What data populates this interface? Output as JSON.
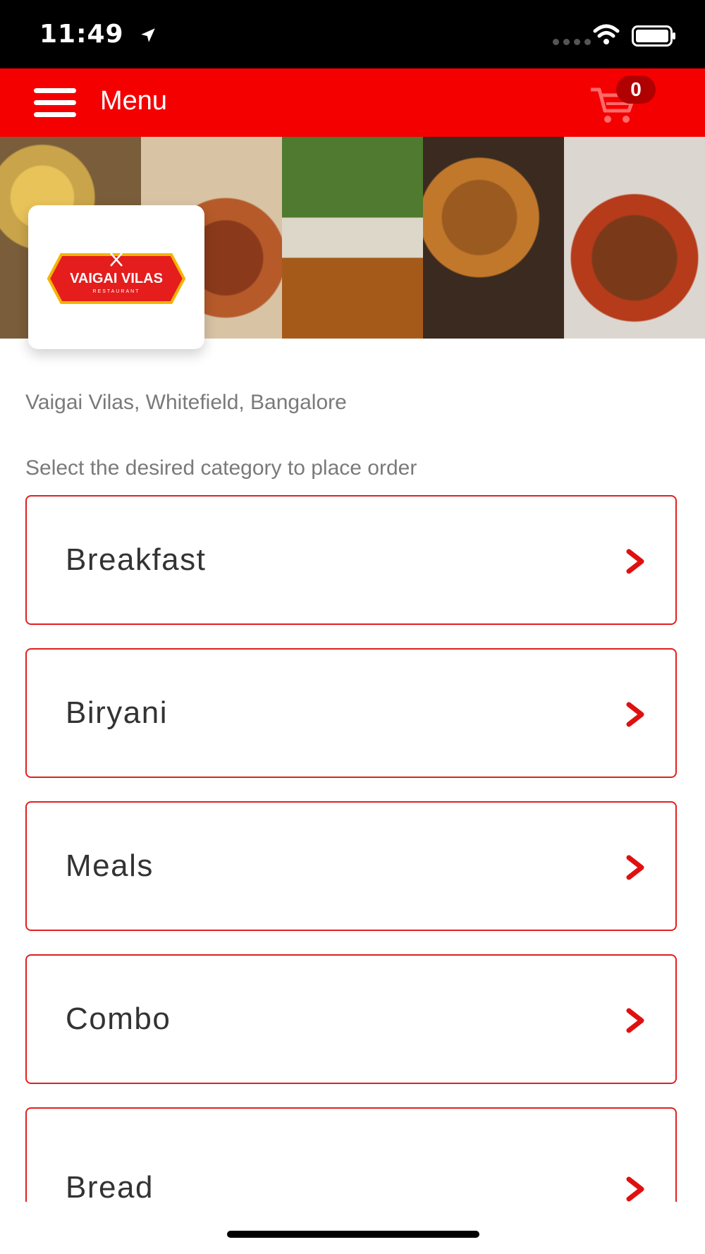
{
  "status_bar": {
    "time": "11:49"
  },
  "header": {
    "title": "Menu",
    "cart_count": "0"
  },
  "restaurant": {
    "logo_text": "VAIGAI VILAS",
    "logo_subtext": "RESTAURANT",
    "location": "Vaigai Vilas, Whitefield, Bangalore"
  },
  "instruction": "Select the desired category to place order",
  "categories": [
    {
      "label": "Breakfast"
    },
    {
      "label": "Biryani"
    },
    {
      "label": "Meals"
    },
    {
      "label": "Combo"
    },
    {
      "label": "Bread"
    }
  ],
  "colors": {
    "brand_red": "#f50000",
    "border_red": "#e02020"
  }
}
